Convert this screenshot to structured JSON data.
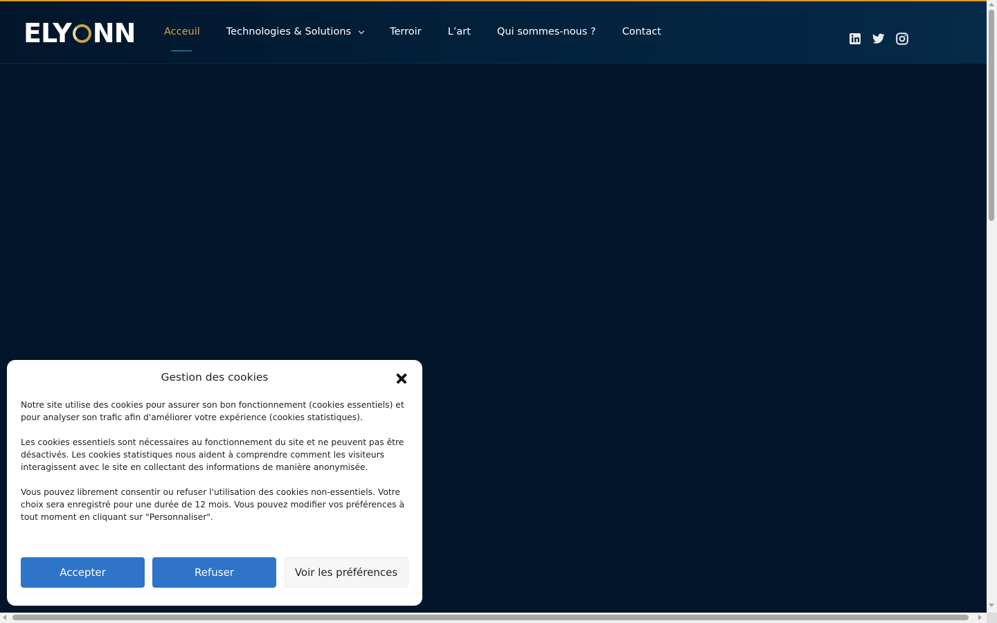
{
  "brand": {
    "logo_left": "ELY",
    "logo_right": "NN",
    "colors": {
      "accent": "#d99a2b",
      "active_nav": "#d9a441",
      "background": "#02152a",
      "button_primary": "#2e74c9"
    }
  },
  "nav": {
    "items": [
      {
        "label": "Acceuil",
        "active": true
      },
      {
        "label": "Technologies & Solutions",
        "has_dropdown": true
      },
      {
        "label": "Terroir"
      },
      {
        "label": "L’art"
      },
      {
        "label": "Qui sommes-nous ?"
      },
      {
        "label": "Contact"
      }
    ]
  },
  "social": {
    "icons": [
      "linkedin-icon",
      "twitter-icon",
      "instagram-icon"
    ]
  },
  "cookie_modal": {
    "title": "Gestion des cookies",
    "paragraphs": [
      "Notre site utilise des cookies pour assurer son bon fonctionnement (cookies essentiels) et pour analyser son trafic afin d'améliorer votre expérience (cookies statistiques).",
      "Les cookies essentiels sont nécessaires au fonctionnement du site et ne peuvent pas être désactivés. Les cookies statistiques nous aident à comprendre comment les visiteurs interagissent avec le site en collectant des informations de manière anonymisée.",
      "Vous pouvez librement consentir ou refuser l'utilisation des cookies non-essentiels. Votre choix sera enregistré pour une durée de 12 mois. Vous pouvez modifier vos préférences à tout moment en cliquant sur \"Personnaliser\"."
    ],
    "buttons": {
      "accept": "Accepter",
      "refuse": "Refuser",
      "preferences": "Voir les préférences"
    }
  }
}
